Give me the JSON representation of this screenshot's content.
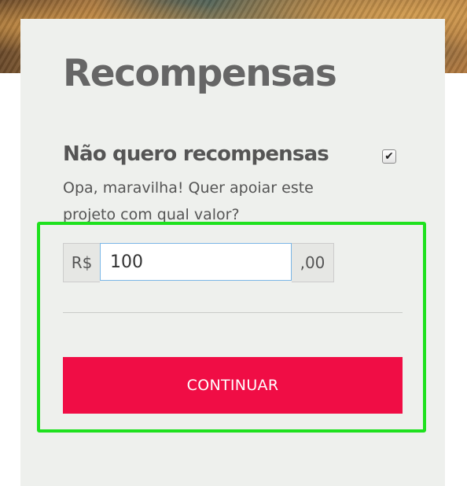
{
  "page": {
    "title": "Recompensas"
  },
  "no_reward": {
    "label": "Não quero recompensas",
    "checked": true,
    "checkmark_glyph": "✔",
    "description": "Opa, maravilha! Quer apoiar este projeto com qual valor?"
  },
  "amount": {
    "currency_prefix": "R$",
    "value": "100",
    "cents_suffix": ",00"
  },
  "actions": {
    "continue_label": "CONTINUAR"
  },
  "colors": {
    "accent_button": "#f00d45",
    "highlight_box": "#1ee11e",
    "input_focus_border": "#7ab6e6"
  }
}
